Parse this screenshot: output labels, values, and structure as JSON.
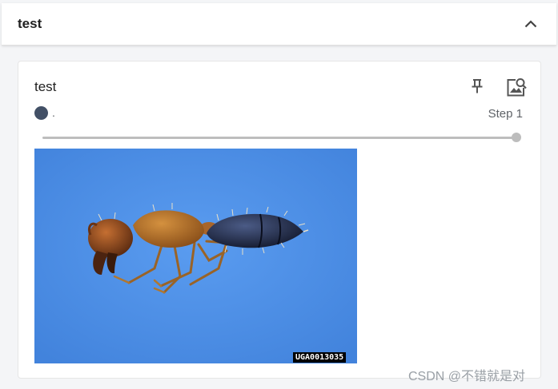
{
  "group": {
    "title": "test",
    "collapse_icon": "chevron-up-icon"
  },
  "card": {
    "title": "test",
    "pin_icon": "pin-icon",
    "fullscreen_icon": "image-search-icon",
    "run": {
      "name": ".",
      "color": "#425066"
    },
    "step_label": "Step 1",
    "slider": {
      "current_step": 1,
      "max_step": 1
    },
    "image": {
      "description_icon": "ant-specimen-image",
      "background_color": "#4a8fe2",
      "caption": "UGA0013035"
    }
  },
  "watermark": "CSDN @不错就是对"
}
